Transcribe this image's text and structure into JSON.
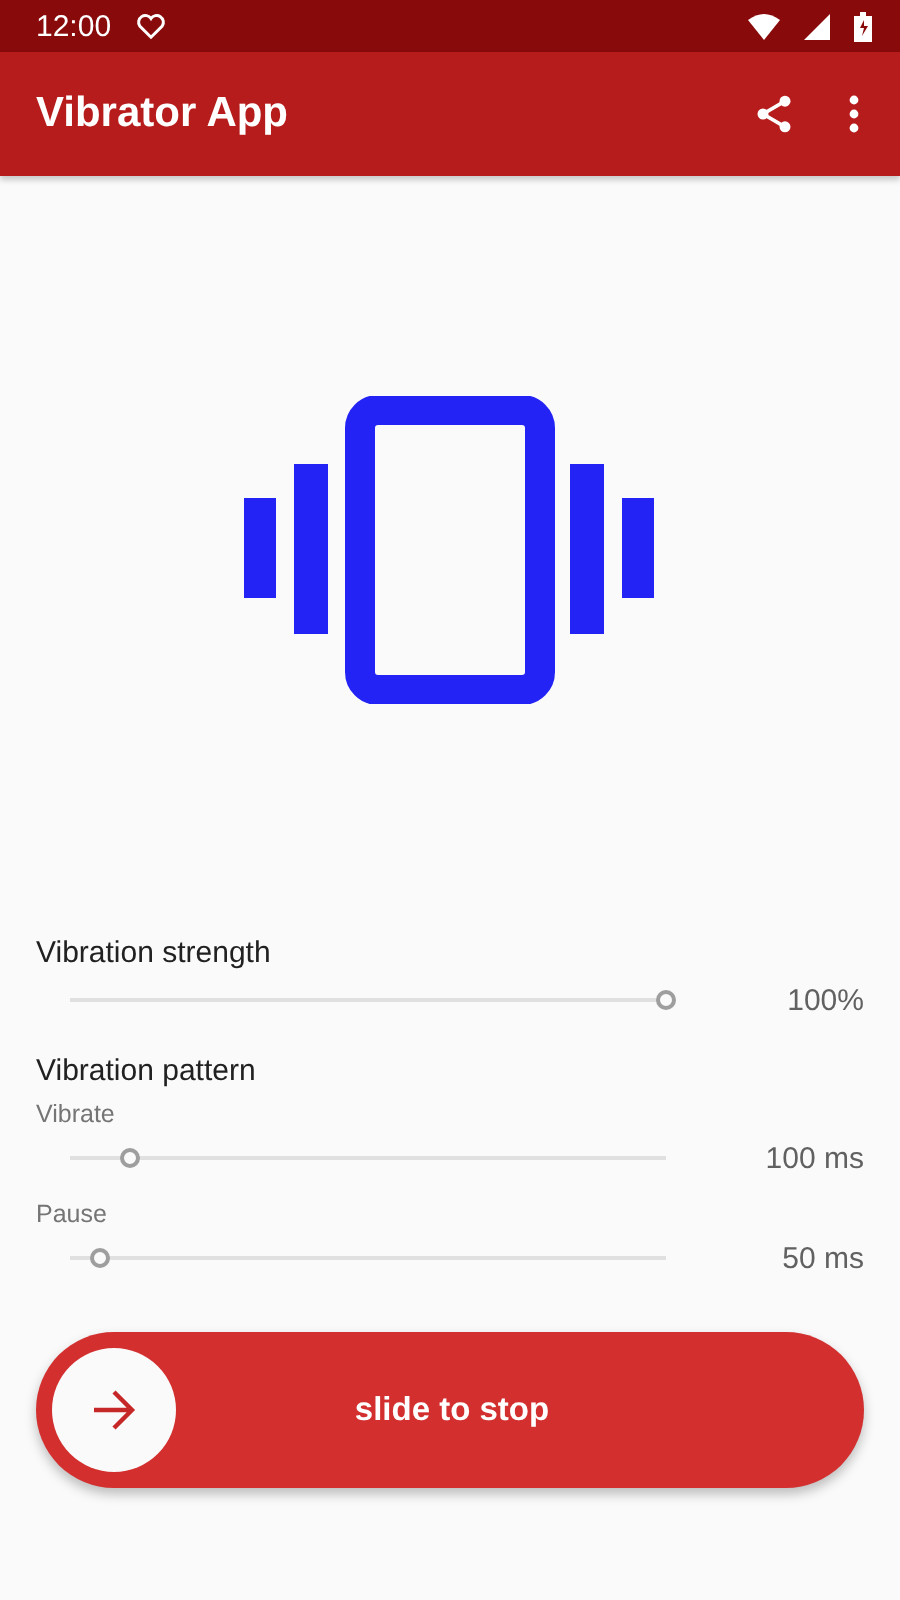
{
  "status_bar": {
    "time": "12:00"
  },
  "app_bar": {
    "title": "Vibrator App"
  },
  "strength": {
    "label": "Vibration strength",
    "level": 1.0,
    "reading": "100%"
  },
  "pattern": {
    "label": "Vibration pattern",
    "sliders": [
      {
        "label": "Vibrate",
        "level": 0.1,
        "reading": "100 ms"
      },
      {
        "label": "Pause",
        "level": 0.05,
        "reading": "50 ms"
      }
    ]
  },
  "slide_button": {
    "label": "slide to stop"
  }
}
